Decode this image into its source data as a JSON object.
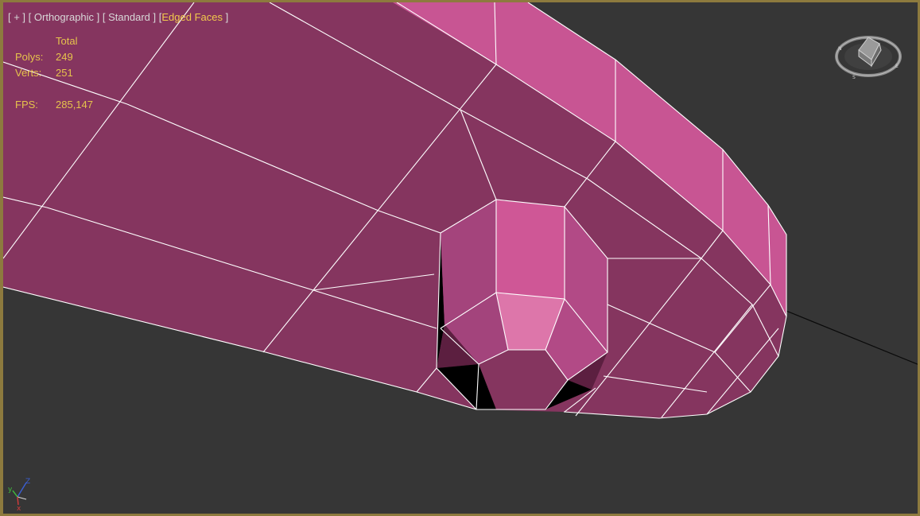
{
  "viewport": {
    "label_plus": "[ + ]",
    "label_view": "[ Orthographic ]",
    "label_shading": "[ Standard ]",
    "label_edged": "Edged Faces",
    "label_edged_open": "[",
    "label_edged_close": " ]",
    "active_color": "#f2c94c"
  },
  "stats": {
    "header": "Total",
    "polys_label": "Polys:",
    "polys_value": "249",
    "verts_label": "Verts:",
    "verts_value": "251",
    "fps_label": "FPS:",
    "fps_value": "285,147"
  },
  "gizmo": {
    "y_label": "y",
    "z_label": "Z",
    "x_label": "x"
  },
  "colors": {
    "background": "#363636",
    "frame": "#8d7a3e",
    "face_dark": "#85355f",
    "face_light": "#c85593",
    "edge": "#ffffff"
  },
  "icons": {
    "viewcube": "viewcube-icon",
    "axis": "axis-tripod-icon"
  }
}
